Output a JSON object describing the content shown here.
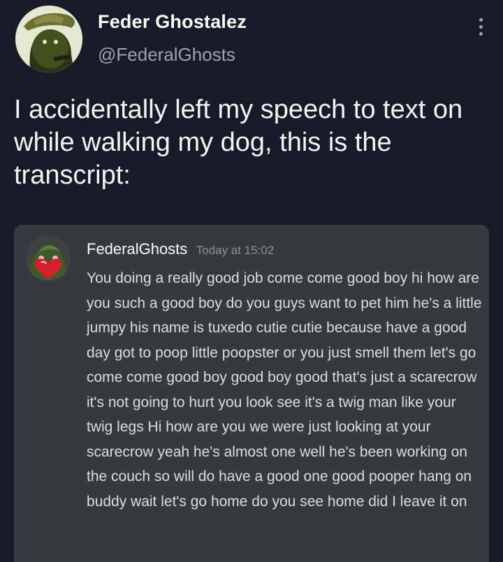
{
  "tweet": {
    "display_name": "Feder Ghostalez",
    "handle": "@FederalGhosts",
    "text": "I accidentally left my speech to text on while walking my dog, this is the transcript:",
    "more_icon": "vertical-ellipsis-icon"
  },
  "discord_message": {
    "username": "FederalGhosts",
    "timestamp": "Today at 15:02",
    "body": "You doing a really good job come come good boy hi how are you such a good boy do you guys want to pet him he's a little jumpy his name is tuxedo cutie cutie because have a good day got to poop little poopster or you just smell them let's go come come good boy good boy good that's just a scarecrow it's not going to hurt you look see it's a twig man like your twig legs Hi how are you we were just looking at your scarecrow yeah he's almost one well he's been working on the couch so will do have a good one good pooper hang on buddy wait let's go home do you see home did I leave it on"
  },
  "colors": {
    "background": "#181b27",
    "card": "#36393f",
    "text_primary": "#ffffff",
    "text_muted": "#9aa3b0",
    "message_text": "#dcddde"
  }
}
